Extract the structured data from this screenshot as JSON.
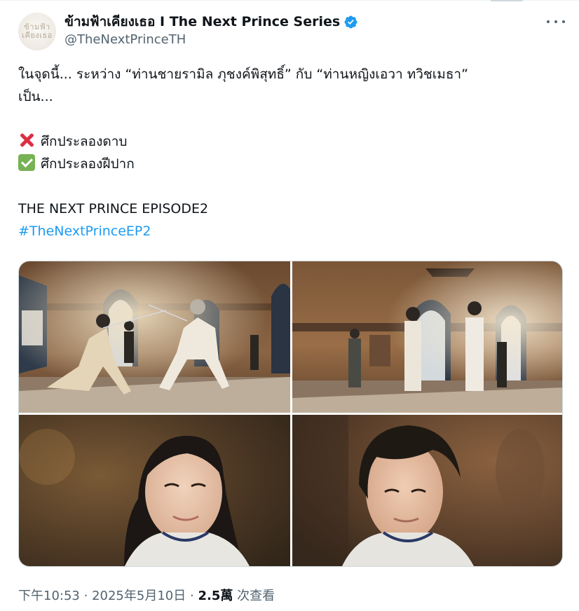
{
  "post": {
    "author": {
      "display_name": "ข้ามฟ้าเคียงเธอ I The Next Prince Series",
      "handle": "@TheNextPrinceTH",
      "avatar_logo_line1": "ข้ามฟ้า",
      "avatar_logo_line2": "เคียงเธอ",
      "verified": true,
      "verified_color": "#1d9bf0"
    },
    "text": {
      "line1": "ในจุดนี้... ระหว่าง “ท่านชายรามิล ภุชงค์พิสุทธิ์” กับ “ท่านหญิงเอวา ทวิชเมธา”",
      "line2": "เป็น...",
      "item1_icon": "cross-mark-emoji",
      "item1_text": "ศึกประลองดาบ",
      "item2_icon": "check-mark-emoji",
      "item2_text": "ศึกประลองฝีปาก",
      "episode_line": "THE NEXT PRINCE EPISODE2",
      "hashtag": "#TheNextPrinceEP2"
    },
    "media": [
      {
        "description": "fencing-duel-wide-shot"
      },
      {
        "description": "fencers-facing-each-other-hall"
      },
      {
        "description": "actress-closeup-smile"
      },
      {
        "description": "actor-closeup-smile"
      }
    ],
    "meta": {
      "time": "下午10:53",
      "separator": "·",
      "date": "2025年5月10日",
      "views_count": "2.5萬",
      "views_label": "次查看"
    }
  },
  "colors": {
    "text": "#0f1419",
    "secondary": "#536471",
    "link": "#1d9bf0",
    "border": "#cfd9de"
  }
}
